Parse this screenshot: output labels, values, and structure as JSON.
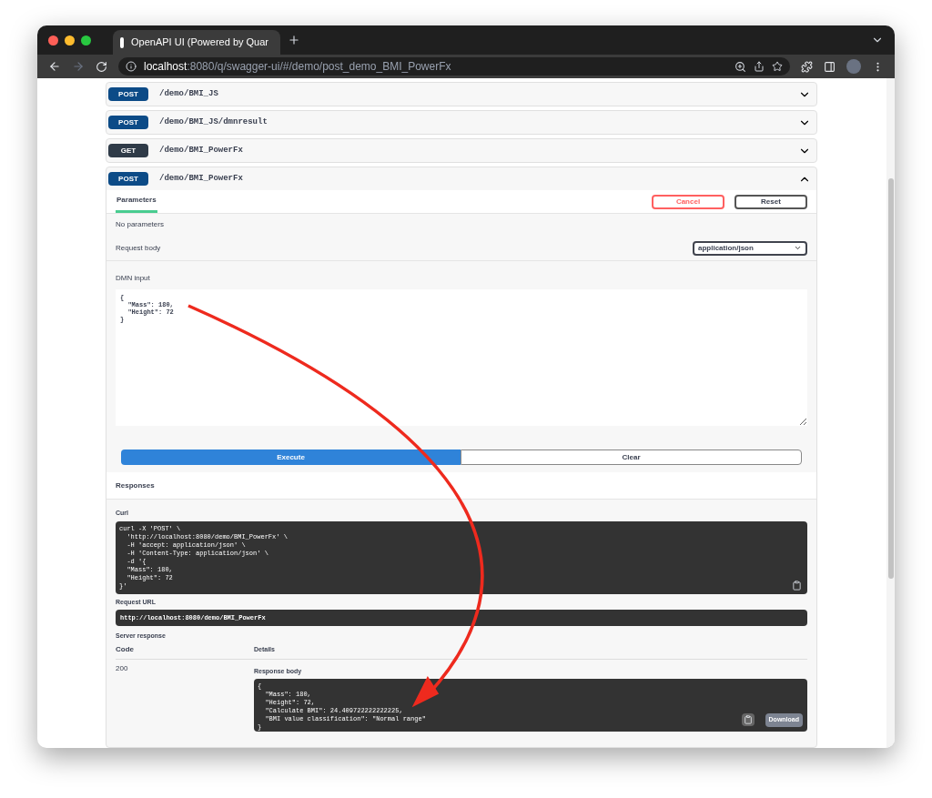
{
  "browser": {
    "tab_title": "OpenAPI UI (Powered by Quar",
    "url_host": "localhost",
    "url_rest": ":8080/q/swagger-ui/#/demo/post_demo_BMI_PowerFx"
  },
  "operations": [
    {
      "method": "POST",
      "path": "/demo/BMI_JS",
      "color": "#0c4b87",
      "expanded": false
    },
    {
      "method": "POST",
      "path": "/demo/BMI_JS/dmnresult",
      "color": "#0c4b87",
      "expanded": false
    },
    {
      "method": "GET",
      "path": "/demo/BMI_PowerFx",
      "color": "#2f3b48",
      "expanded": false
    },
    {
      "method": "POST",
      "path": "/demo/BMI_PowerFx",
      "color": "#0c4b87",
      "expanded": true
    }
  ],
  "details": {
    "tab": {
      "label": "Parameters",
      "selected": true
    },
    "cancel": "Cancel",
    "reset": "Reset",
    "no_params": "No parameters",
    "request_body_label": "Request body",
    "content_type": "application/json",
    "input_label": "DMN input",
    "input_value": "{\n  \"Mass\": 180,\n  \"Height\": 72\n}",
    "execute": "Execute",
    "clear": "Clear",
    "responses_title": "Responses",
    "curl_label": "Curl",
    "curl_code": "curl -X 'POST' \\\n  'http://localhost:8080/demo/BMI_PowerFx' \\\n  -H 'accept: application/json' \\\n  -H 'Content-Type: application/json' \\\n  -d '{\n  \"Mass\": 180,\n  \"Height\": 72\n}'",
    "request_url_label": "Request URL",
    "request_url": "http://localhost:8080/demo/BMI_PowerFx",
    "server_response_label": "Server response",
    "code_header": "Code",
    "details_header": "Details",
    "status_code": "200",
    "response_body_label": "Response body",
    "response_body": "{\n  \"Mass\": 180,\n  \"Height\": 72,\n  \"Calculate BMI\": 24.409722222222225,\n  \"BMI value classification\": \"Normal range\"\n}",
    "download": "Download"
  }
}
